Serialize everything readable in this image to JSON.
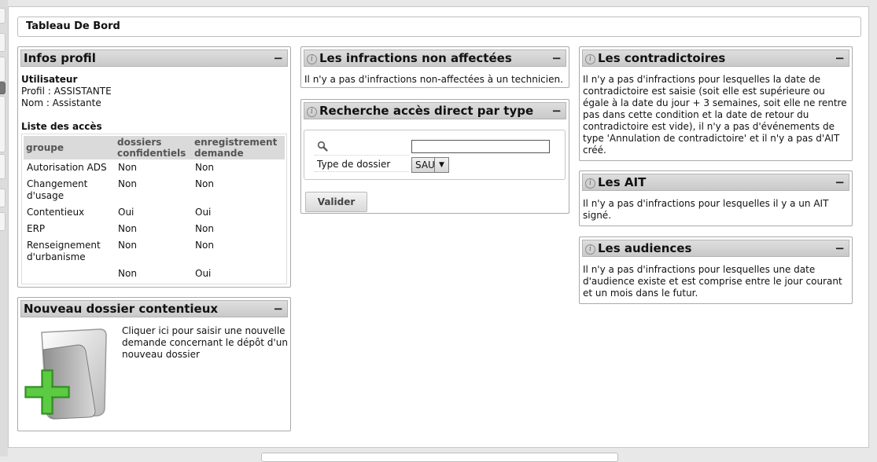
{
  "title": "Tableau De Bord",
  "infos_profil": {
    "title": "Infos profil",
    "collapse": "−",
    "user_heading": "Utilisateur",
    "profil_line": "Profil : ASSISTANTE",
    "nom_line": "Nom : Assistante",
    "access_heading": "Liste des accès",
    "columns": [
      "groupe",
      "dossiers confidentiels",
      "enregistrement demande"
    ],
    "rows": [
      [
        "Autorisation ADS",
        "Non",
        "Non"
      ],
      [
        "Changement d'usage",
        "Non",
        "Non"
      ],
      [
        "Contentieux",
        "Oui",
        "Oui"
      ],
      [
        "ERP",
        "Non",
        "Non"
      ],
      [
        "Renseignement d'urbanisme",
        "Non",
        "Non"
      ],
      [
        "",
        "Non",
        "Oui"
      ]
    ]
  },
  "nouveau_dossier": {
    "title": "Nouveau dossier contentieux",
    "collapse": "−",
    "text": "Cliquer ici pour saisir une nouvelle demande concernant le dépôt d'un nouveau dossier",
    "icon": "folder-add-icon"
  },
  "infractions": {
    "title": "Les infractions non affectées",
    "collapse": "−",
    "text": "Il n'y a pas d'infractions non-affectées à un technicien."
  },
  "recherche": {
    "title": "Recherche accès direct par type",
    "collapse": "−",
    "search_value": "",
    "type_label": "Type de dossier",
    "type_value": "SAU",
    "submit": "Valider"
  },
  "contradictoires": {
    "title": "Les contradictoires",
    "collapse": "−",
    "text": "Il n'y a pas d'infractions pour lesquelles la date de contradictoire est saisie (soit elle est supérieure ou égale à la date du jour + 3 semaines, soit elle ne rentre pas dans cette condition et la date de retour du contradictoire est vide), il n'y a pas d'événements de type 'Annulation de contradictoire' et il n'y a pas d'AIT créé."
  },
  "ait": {
    "title": "Les AIT",
    "collapse": "−",
    "text": "Il n'y a pas d'infractions pour lesquelles il y a un AIT signé."
  },
  "audiences": {
    "title": "Les audiences",
    "collapse": "−",
    "text": "Il n'y a pas d'infractions pour lesquelles une date d'audience existe et est comprise entre le jour courant et un mois dans le futur."
  },
  "colors": {
    "header_bg": "#d4d4d4",
    "accent_green": "#3fae2a",
    "border": "#aaaaaa"
  }
}
